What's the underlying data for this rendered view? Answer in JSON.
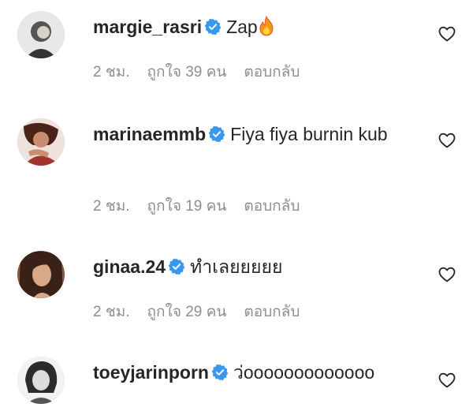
{
  "comments": [
    {
      "username": "margie_rasri",
      "text": "Zap",
      "time": "2 ชม.",
      "likes": "ถูกใจ 39 คน",
      "reply": "ตอบกลับ",
      "emoji": "fire-icon",
      "verified": true
    },
    {
      "username": "marinaemmb",
      "text": "Fiya fiya burnin kub",
      "time": "2 ชม.",
      "likes": "ถูกใจ 19 คน",
      "reply": "ตอบกลับ",
      "verified": true
    },
    {
      "username": "ginaa.24",
      "text": "ทำเลยยยยย",
      "time": "2 ชม.",
      "likes": "ถูกใจ 29 คน",
      "reply": "ตอบกลับ",
      "verified": true
    },
    {
      "username": "toeyjarinporn",
      "text": "ว่ooooooooooooo",
      "verified": true
    }
  ],
  "colors": {
    "verified_badge": "#3897f0",
    "text": "#262626",
    "meta": "#8e8e8e"
  }
}
